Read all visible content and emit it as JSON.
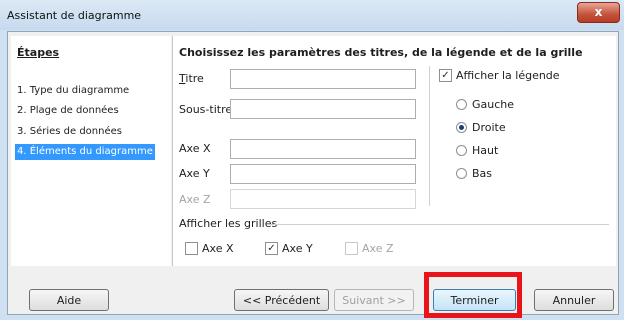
{
  "window": {
    "title": "Assistant de diagramme",
    "close_glyph": "x"
  },
  "steps": {
    "title": "Étapes",
    "items": [
      {
        "label": "1. Type du diagramme"
      },
      {
        "label": "2. Plage de données"
      },
      {
        "label": "3. Séries de données"
      },
      {
        "label": "4. Éléments du diagramme"
      }
    ]
  },
  "main": {
    "heading": "Choisissez les paramètres des titres, de la légende et de la grille",
    "title_label": "Titre",
    "subtitle_label": "Sous-titre",
    "axis_x_label": "Axe X",
    "axis_y_label": "Axe Y",
    "axis_z_label": "Axe Z",
    "title_value": "",
    "subtitle_value": "",
    "axis_x_value": "",
    "axis_y_value": "",
    "axis_z_value": ""
  },
  "legend": {
    "show_label": "Afficher la légende",
    "show_checked": true,
    "options": [
      {
        "label": "Gauche",
        "selected": false
      },
      {
        "label": "Droite",
        "selected": true
      },
      {
        "label": "Haut",
        "selected": false
      },
      {
        "label": "Bas",
        "selected": false
      }
    ]
  },
  "grids": {
    "label": "Afficher les grilles",
    "x_label": "Axe X",
    "x_checked": false,
    "y_label": "Axe Y",
    "y_checked": true,
    "z_label": "Axe Z",
    "z_checked": false
  },
  "buttons": {
    "help": "Aide",
    "previous": "<< Précédent",
    "next": "Suivant >>",
    "finish": "Terminer",
    "cancel": "Annuler"
  },
  "colors": {
    "highlight": "#e8141a",
    "selection": "#3399ff"
  }
}
